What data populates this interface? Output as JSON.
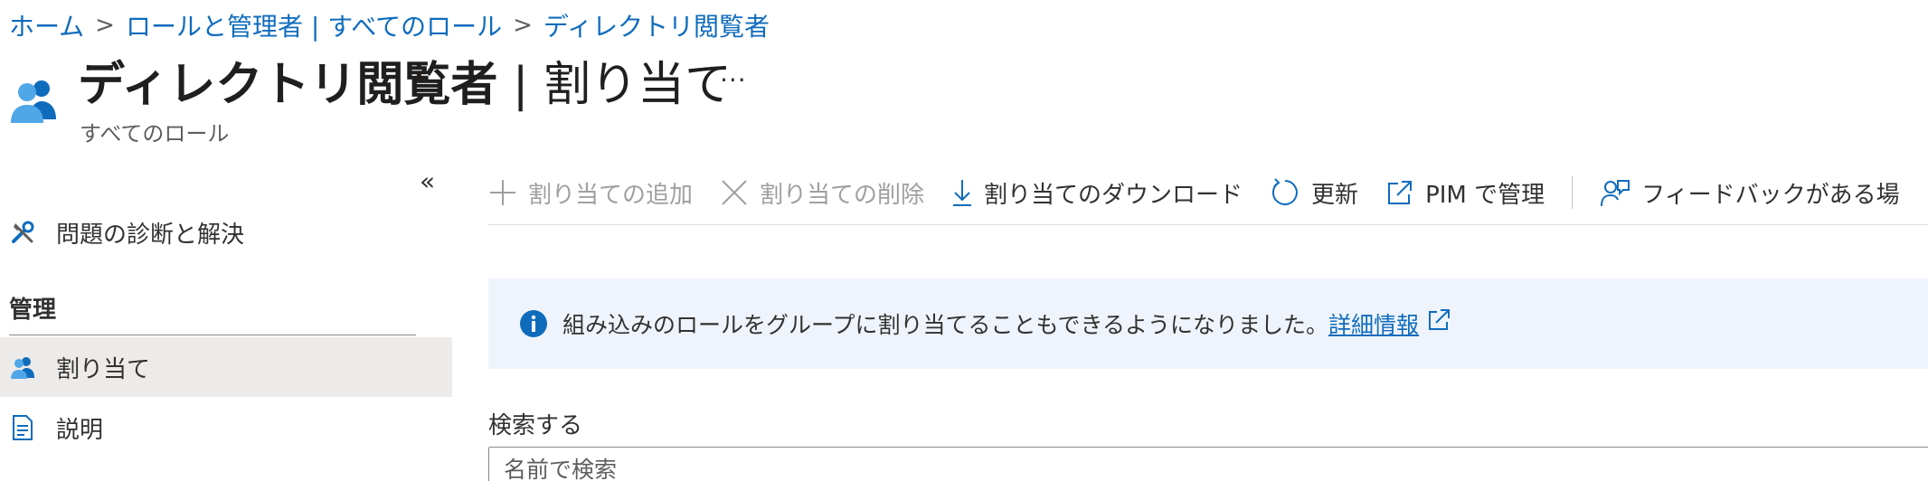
{
  "breadcrumb": {
    "items": [
      "ホーム",
      "ロールと管理者 | すべてのロール",
      "ディレクトリ閲覧者"
    ],
    "separator": ">"
  },
  "header": {
    "title_bold": "ディレクトリ閲覧者",
    "title_rest": " | 割り当て",
    "more": "···",
    "subtitle": "すべてのロール",
    "icon": "users-icon"
  },
  "nav": {
    "collapse": "«",
    "diagnose": "問題の診断と解決",
    "section_heading": "管理",
    "assignments": "割り当て",
    "description": "説明"
  },
  "toolbar": {
    "add": "割り当ての追加",
    "remove": "割り当ての削除",
    "download": "割り当てのダウンロード",
    "refresh": "更新",
    "pim": "PIM で管理",
    "feedback": "フィードバックがある場"
  },
  "banner": {
    "text": "組み込みのロールをグループに割り当てることもできるようになりました。",
    "link": "詳細情報"
  },
  "search": {
    "label": "検索する",
    "placeholder": "名前で検索"
  },
  "colors": {
    "accent": "#0f6cbd",
    "banner_bg": "#eff4fc",
    "selected_bg": "#edebe9"
  }
}
